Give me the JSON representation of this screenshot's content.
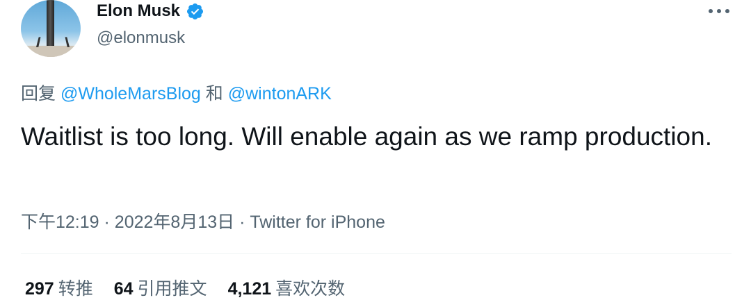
{
  "author": {
    "name": "Elon Musk",
    "handle": "@elonmusk",
    "verified_color": "#1d9bf0"
  },
  "reply": {
    "prefix": "回复",
    "mention1": "@WholeMarsBlog",
    "joiner": "和",
    "mention2": "@wintonARK"
  },
  "tweet": {
    "text": "Waitlist is too long. Will enable again as we ramp production."
  },
  "meta": {
    "time": "下午12:19",
    "sep1": "·",
    "date": "2022年8月13日",
    "sep2": "·",
    "source": "Twitter for iPhone"
  },
  "stats": [
    {
      "count": "297",
      "label": "转推"
    },
    {
      "count": "64",
      "label": "引用推文"
    },
    {
      "count": "4,121",
      "label": "喜欢次数"
    }
  ],
  "icons": {
    "verified": "verified-badge-icon",
    "more": "more-options-icon"
  }
}
